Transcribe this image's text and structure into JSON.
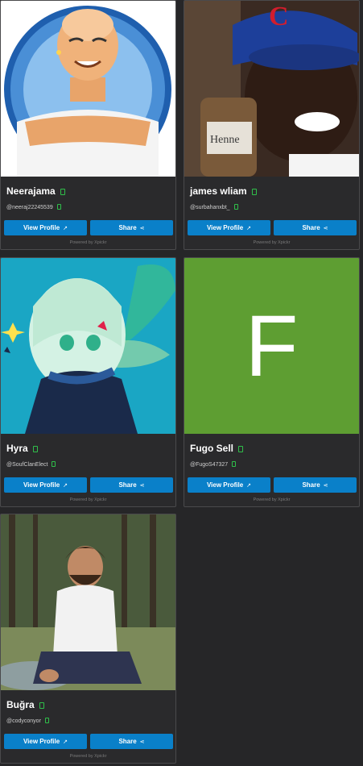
{
  "cards": [
    {
      "name": "Neerajama",
      "handle": "@neeraj22245539",
      "view_label": "View Profile",
      "share_label": "Share",
      "powered": "Powered by Xpickr",
      "name_icon": "clipboard-icon",
      "handle_icon": "clipboard-icon"
    },
    {
      "name": "james wliam",
      "handle": "@surbahanxbt_",
      "view_label": "View Profile",
      "share_label": "Share",
      "powered": "Powered by Xpickr"
    },
    {
      "name": "Hyra",
      "handle": "@SoufClanElect",
      "view_label": "View Profile",
      "share_label": "Share",
      "powered": "Powered by Xpickr"
    },
    {
      "name": "Fugo Sell",
      "handle": "@FugoS47327",
      "view_label": "View Profile",
      "share_label": "Share",
      "powered": "Powered by Xpickr",
      "avatar_letter": "F"
    },
    {
      "name": "Buğra",
      "handle": "@codyconyor",
      "view_label": "View Profile",
      "share_label": "Share",
      "powered": "Powered by Xpickr"
    }
  ],
  "colors": {
    "background": "#262628",
    "card": "#2a2a2c",
    "button": "#0a80c9",
    "copy_icon": "#2fbf4a",
    "fugo_avatar": "#5e9e32"
  }
}
